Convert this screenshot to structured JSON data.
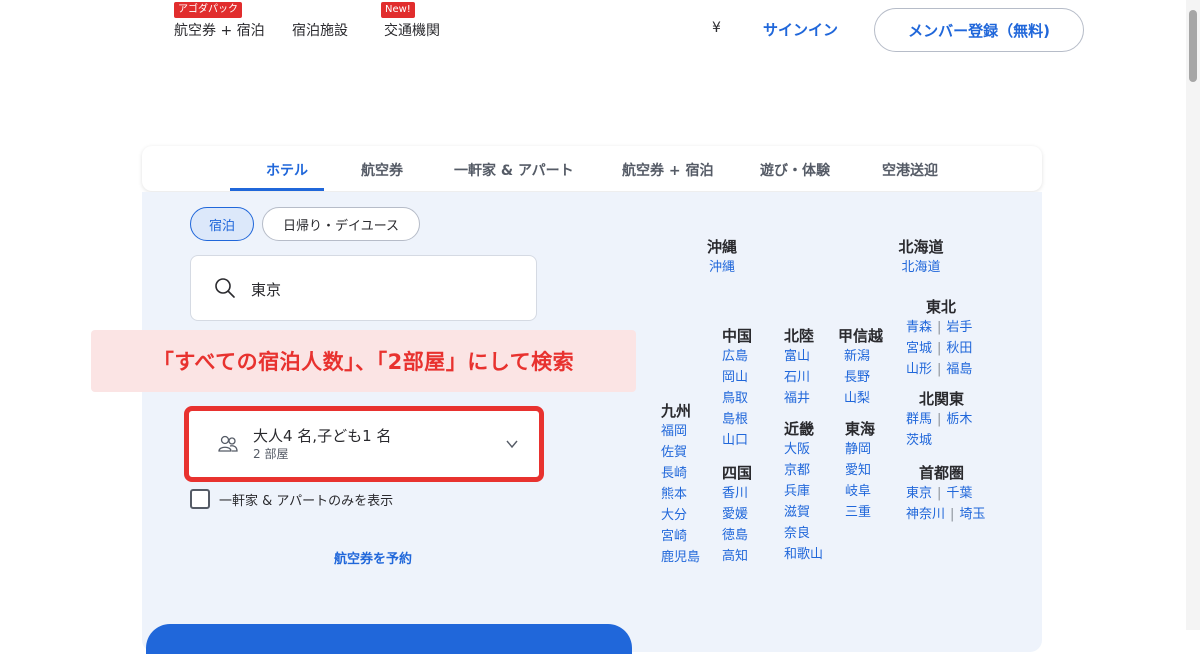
{
  "nav": {
    "items": [
      {
        "label": "航空券 + 宿泊",
        "badge": "アゴダパック"
      },
      {
        "label": "宿泊施設",
        "badge": ""
      },
      {
        "label": "交通機関",
        "badge": "New!"
      }
    ],
    "currency": "¥",
    "signin": "サインイン",
    "register": "メンバー登録（無料)"
  },
  "tabs": [
    "ホテル",
    "航空券",
    "一軒家 & アパート",
    "航空券 + 宿泊",
    "遊び・体験",
    "空港送迎"
  ],
  "stay_types": {
    "overnight": "宿泊",
    "dayuse": "日帰り・デイユース"
  },
  "search": {
    "value": "東京"
  },
  "guests": {
    "main": "大人4 名,子ども1 名",
    "rooms": "2 部屋"
  },
  "filter": {
    "label": "一軒家 & アパートのみを表示"
  },
  "flight_link": "航空券を予約",
  "annotation": "「すべての宿泊人数」、「2部屋」にして検索",
  "regions": {
    "okinawa": {
      "title": "沖縄",
      "prefs": [
        "沖縄"
      ]
    },
    "hokkaido": {
      "title": "北海道",
      "prefs": [
        "北海道"
      ]
    },
    "tohoku": {
      "title": "東北",
      "pairs": [
        [
          "青森",
          "岩手"
        ],
        [
          "宮城",
          "秋田"
        ],
        [
          "山形",
          "福島"
        ]
      ]
    },
    "chugoku": {
      "title": "中国",
      "prefs": [
        "広島",
        "岡山",
        "鳥取",
        "島根",
        "山口"
      ]
    },
    "hokuriku": {
      "title": "北陸",
      "prefs": [
        "富山",
        "石川",
        "福井"
      ]
    },
    "koshinetsu": {
      "title": "甲信越",
      "prefs": [
        "新潟",
        "長野",
        "山梨"
      ]
    },
    "kitakanto": {
      "title": "北関東",
      "pairs": [
        [
          "群馬",
          "栃木"
        ],
        [
          "茨城"
        ]
      ]
    },
    "kyushu": {
      "title": "九州",
      "prefs": [
        "福岡",
        "佐賀",
        "長崎",
        "熊本",
        "大分",
        "宮崎",
        "鹿児島"
      ]
    },
    "kinki": {
      "title": "近畿",
      "prefs": [
        "大阪",
        "京都",
        "兵庫",
        "滋賀",
        "奈良",
        "和歌山"
      ]
    },
    "tokai": {
      "title": "東海",
      "prefs": [
        "静岡",
        "愛知",
        "岐阜",
        "三重"
      ]
    },
    "shikoku": {
      "title": "四国",
      "prefs": [
        "香川",
        "愛媛",
        "徳島",
        "高知"
      ]
    },
    "shutoken": {
      "title": "首都圏",
      "pairs": [
        [
          "東京",
          "千葉"
        ],
        [
          "神奈川",
          "埼玉"
        ]
      ]
    }
  }
}
